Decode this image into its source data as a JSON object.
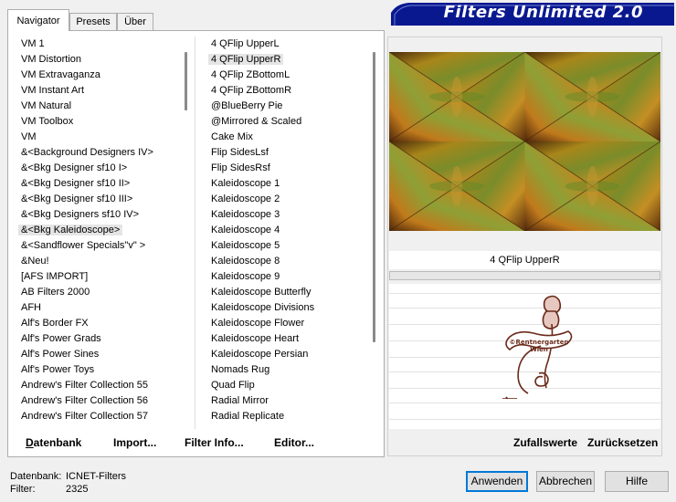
{
  "tabs": [
    "Navigator",
    "Presets",
    "Über"
  ],
  "banner_title": "Filters Unlimited 2.0",
  "categories": [
    "VM 1",
    "VM Distortion",
    "VM Extravaganza",
    "VM Instant Art",
    "VM Natural",
    "VM Toolbox",
    "VM",
    "&<Background Designers IV>",
    "&<Bkg Designer sf10 I>",
    "&<Bkg Designer sf10 II>",
    "&<Bkg Designer sf10 III>",
    "&<Bkg Designers sf10 IV>",
    "&<Bkg Kaleidoscope>",
    "&<Sandflower Specials\"v\" >",
    "&Neu!",
    "[AFS IMPORT]",
    "AB Filters 2000",
    "AFH",
    "Alf's Border FX",
    "Alf's Power Grads",
    "Alf's Power Sines",
    "Alf's Power Toys",
    "Andrew's Filter Collection 55",
    "Andrew's Filter Collection 56",
    "Andrew's Filter Collection 57"
  ],
  "categories_selected_index": 12,
  "filters": [
    "4 QFlip UpperL",
    "4 QFlip UpperR",
    "4 QFlip ZBottomL",
    "4 QFlip ZBottomR",
    "@BlueBerry Pie",
    "@Mirrored & Scaled",
    "Cake Mix",
    "Flip SidesLsf",
    "Flip SidesRsf",
    "Kaleidoscope 1",
    "Kaleidoscope 2",
    "Kaleidoscope 3",
    "Kaleidoscope 4",
    "Kaleidoscope 5",
    "Kaleidoscope 8",
    "Kaleidoscope 9",
    "Kaleidoscope Butterfly",
    "Kaleidoscope Divisions",
    "Kaleidoscope Flower",
    "Kaleidoscope Heart",
    "Kaleidoscope Persian",
    "Nomads Rug",
    "Quad Flip",
    "Radial Mirror",
    "Radial Replicate"
  ],
  "filters_selected_index": 1,
  "list_buttons": {
    "datenbank": "Datenbank",
    "import": "Import...",
    "filter_info": "Filter Info...",
    "editor": "Editor..."
  },
  "selected_filter_name": "4 QFlip UpperR",
  "preview_buttons": {
    "random": "Zufallswerte",
    "reset": "Zurücksetzen"
  },
  "watermark_text": {
    "line1": "©Rentnergarten",
    "line2": "Wien"
  },
  "status": {
    "db_label": "Datenbank:",
    "db_value": "ICNET-Filters",
    "filter_label": "Filter:",
    "filter_value": "2325"
  },
  "dialog_buttons": {
    "apply": "Anwenden",
    "cancel": "Abbrechen",
    "help": "Hilfe"
  },
  "colors": {
    "banner_blue": "#0a1890",
    "accent_border": "#0078d7",
    "stamp_brown": "#6a2a1a"
  }
}
